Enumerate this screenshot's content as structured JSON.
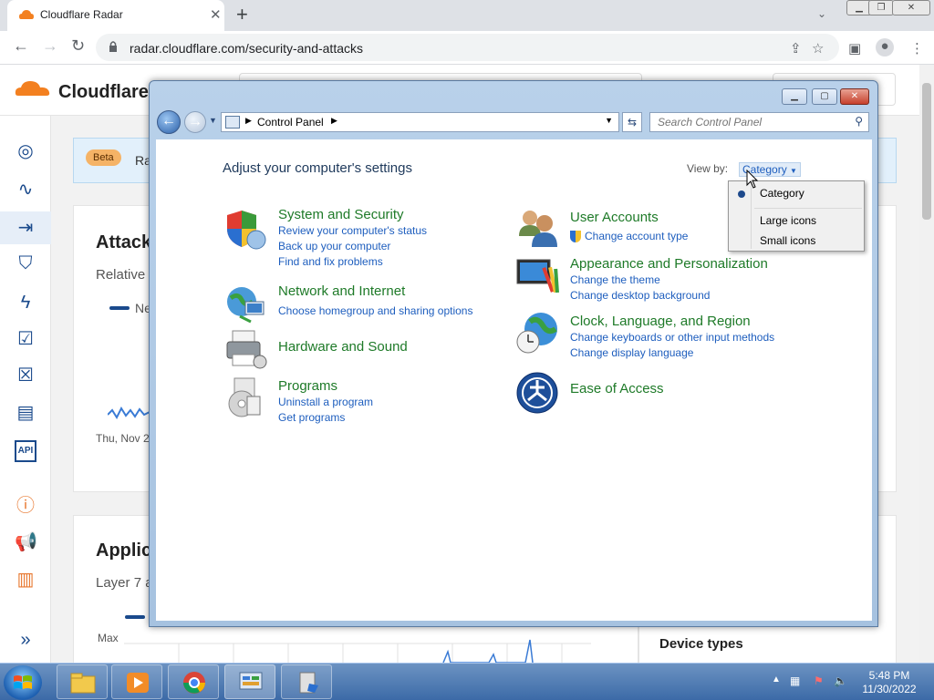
{
  "browser": {
    "tab_title": "Cloudflare Radar",
    "url": "radar.cloudflare.com/security-and-attacks",
    "new_tab": "+"
  },
  "cloudflare": {
    "logo_text": "Cloudflare",
    "beta_badge": "Beta",
    "banner_text": "Ra",
    "card1_title": "Attack",
    "card1_sub": "Relative",
    "legend_fragment": "Ne",
    "date_fragment": "Thu, Nov 2",
    "card2_title": "Applic",
    "card2_sub": "Layer 7 a",
    "max_label": "Max",
    "device_types": "Device types"
  },
  "control_panel": {
    "breadcrumb": "Control Panel",
    "search_placeholder": "Search Control Panel",
    "heading": "Adjust your computer's settings",
    "view_by_label": "View by:",
    "view_by_value": "Category",
    "categories": [
      {
        "title": "System and Security",
        "links": [
          "Review your computer's status",
          "Back up your computer",
          "Find and fix problems"
        ]
      },
      {
        "title": "Network and Internet",
        "links": [
          "Choose homegroup and sharing options"
        ]
      },
      {
        "title": "Hardware and Sound",
        "links": []
      },
      {
        "title": "Programs",
        "links": [
          "Uninstall a program",
          "Get programs"
        ]
      },
      {
        "title": "User Accounts",
        "links": [
          "Change account type"
        ]
      },
      {
        "title": "Appearance and Personalization",
        "links": [
          "Change the theme",
          "Change desktop background"
        ]
      },
      {
        "title": "Clock, Language, and Region",
        "links": [
          "Change keyboards or other input methods",
          "Change display language"
        ]
      },
      {
        "title": "Ease of Access",
        "links": []
      }
    ],
    "view_menu": {
      "items": [
        "Category",
        "Large icons",
        "Small icons"
      ],
      "selected": "Category"
    }
  },
  "taskbar": {
    "time": "5:48 PM",
    "date": "11/30/2022"
  },
  "colors": {
    "category_title": "#1e7a28",
    "link": "#1e5ebe",
    "heading": "#1e395b",
    "cf_orange": "#f38020"
  }
}
